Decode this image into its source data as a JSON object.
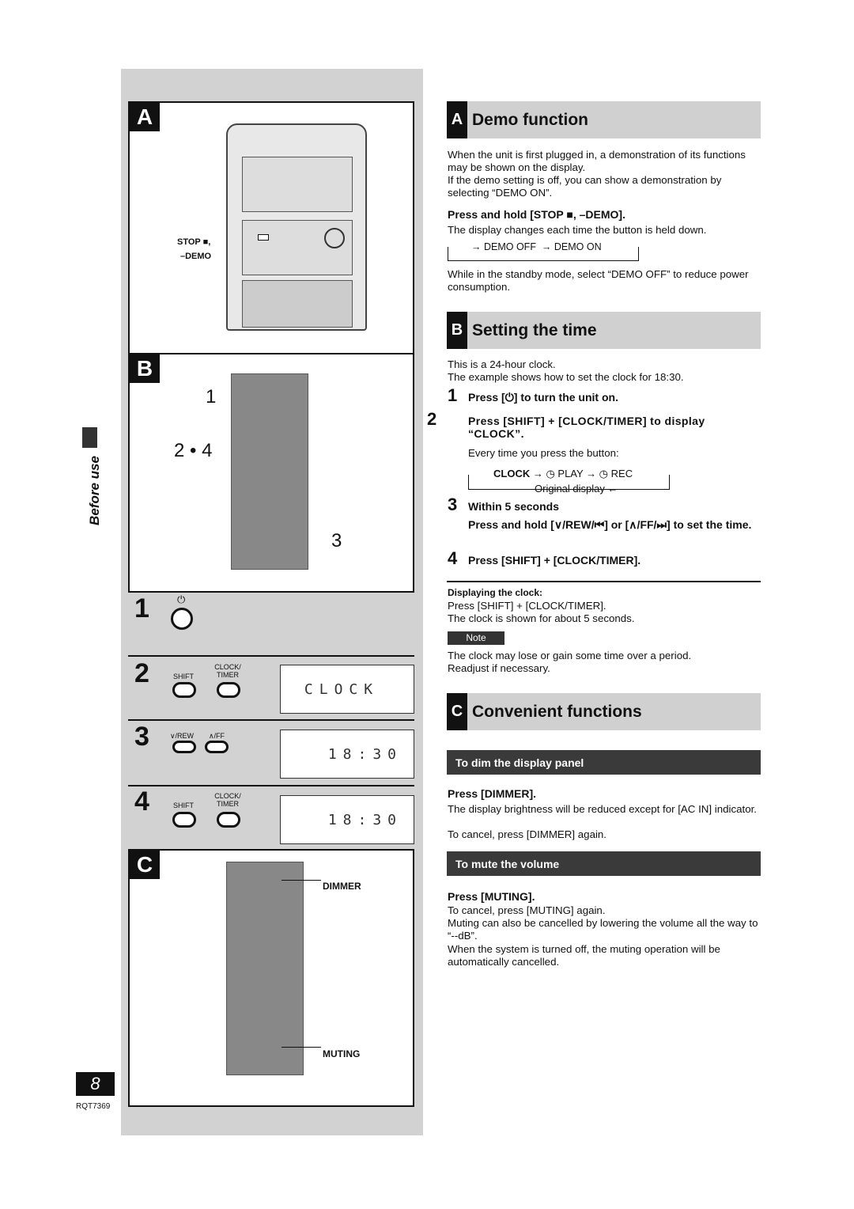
{
  "sidebar": {
    "section_label": "Before use",
    "page_number": "8",
    "doc_code": "RQT7369"
  },
  "figures": {
    "a": {
      "tag": "A",
      "callout": "STOP ■,",
      "callout2": "–DEMO"
    },
    "b": {
      "tag": "B",
      "callouts": [
        "1",
        "2 • 4",
        "3"
      ]
    },
    "steps": [
      {
        "num": "1",
        "buttons": [
          "⏻"
        ]
      },
      {
        "num": "2",
        "buttons": [
          "SHIFT",
          "CLOCK/\nTIMER"
        ],
        "display": "CLOCK"
      },
      {
        "num": "3",
        "buttons": [
          "∨/REW",
          "∧/FF"
        ],
        "display": "18:30"
      },
      {
        "num": "4",
        "buttons": [
          "SHIFT",
          "CLOCK/\nTIMER"
        ],
        "display": "18:30"
      }
    ],
    "c": {
      "tag": "C",
      "callouts": [
        "DIMMER",
        "MUTING"
      ]
    }
  },
  "sections": {
    "a": {
      "letter": "A",
      "title": "Demo function",
      "intro1": "When the unit is first plugged in, a demonstration of its functions may be shown on the display.",
      "intro2": "If the demo setting is off, you can show a demonstration by selecting “DEMO ON”.",
      "step": "Press and hold [STOP ■, –DEMO].",
      "desc": "The display changes each time the button is held down.",
      "cycle": [
        "DEMO OFF",
        "DEMO ON"
      ],
      "note": "While in the standby mode, select “DEMO OFF” to reduce power consumption."
    },
    "b": {
      "letter": "B",
      "title": "Setting the time",
      "intro1": "This is a 24-hour clock.",
      "intro2": "The example shows how to set the clock for 18:30.",
      "steps": [
        {
          "num": "1",
          "text": "Press [⏻] to turn the unit on."
        },
        {
          "num": "2",
          "text": "Press [SHIFT] + [CLOCK/TIMER] to display “CLOCK”.",
          "detail": "Every time you press the button:"
        },
        {
          "num": "3",
          "text": "Within 5 seconds",
          "text2": "Press and hold [∨/REW/⏮] or [∧/FF/⏭] to set the time."
        },
        {
          "num": "4",
          "text": "Press [SHIFT] + [CLOCK/TIMER]."
        }
      ],
      "cycle": [
        "CLOCK",
        "→ ◷ PLAY → ◷ REC"
      ],
      "cycle_return": "Original display ←",
      "displaying_title": "Displaying the clock:",
      "displaying1": "Press [SHIFT] + [CLOCK/TIMER].",
      "displaying2": "The clock is shown for about 5 seconds.",
      "note_label": "Note",
      "note1": "The clock may lose or gain some time over a period.",
      "note2": "Readjust if necessary."
    },
    "c": {
      "letter": "C",
      "title": "Convenient functions",
      "dim_title": "To dim the display panel",
      "dim_step": "Press [DIMMER].",
      "dim1": "The display brightness will be reduced except for [AC IN] indicator.",
      "dim2": "To cancel, press [DIMMER] again.",
      "mute_title": "To mute the volume",
      "mute_step": "Press [MUTING].",
      "mute1": "To cancel, press [MUTING] again.",
      "mute2": "Muting can also be cancelled by lowering the volume all the way to “--dB”.",
      "mute3": "When the system is turned off, the muting operation will be automatically cancelled."
    }
  }
}
